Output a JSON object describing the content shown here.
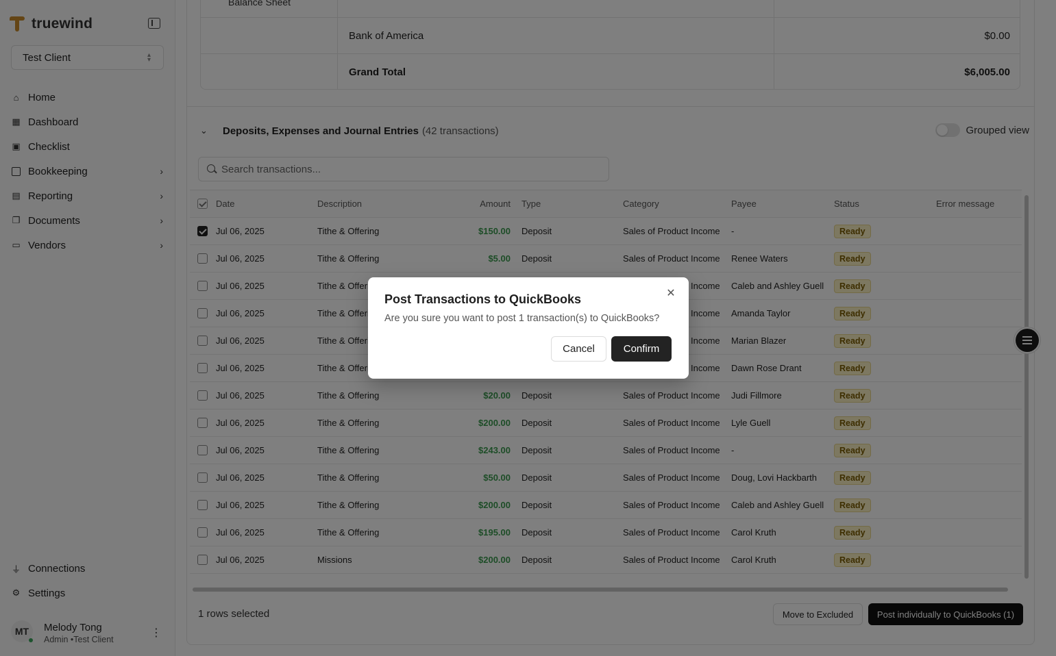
{
  "app": {
    "name": "truewind"
  },
  "client_select": {
    "value": "Test Client"
  },
  "nav": {
    "items": [
      {
        "label": "Home",
        "icon": "home-icon"
      },
      {
        "label": "Dashboard",
        "icon": "grid-icon"
      },
      {
        "label": "Checklist",
        "icon": "calendar-icon"
      },
      {
        "label": "Bookkeeping",
        "icon": "book-icon"
      },
      {
        "label": "Reporting",
        "icon": "report-icon"
      },
      {
        "label": "Documents",
        "icon": "documents-icon"
      },
      {
        "label": "Vendors",
        "icon": "wallet-icon"
      }
    ],
    "bottom": [
      {
        "label": "Connections",
        "icon": "plug-icon"
      },
      {
        "label": "Settings",
        "icon": "gear-icon"
      }
    ]
  },
  "user": {
    "initials": "MT",
    "name": "Melody Tong",
    "role": "Admin •Test Client"
  },
  "summary": {
    "top_label": "Balance Sheet",
    "rows": [
      {
        "label": "Bank of America",
        "value": "$0.00"
      },
      {
        "label": "Grand Total",
        "value": "$6,005.00"
      }
    ]
  },
  "section": {
    "title": "Deposits, Expenses and Journal Entries",
    "count": "(42 transactions)",
    "grouped_label": "Grouped view"
  },
  "search": {
    "placeholder": "Search transactions..."
  },
  "table": {
    "headers": {
      "date": "Date",
      "description": "Description",
      "amount": "Amount",
      "type": "Type",
      "category": "Category",
      "payee": "Payee",
      "status": "Status",
      "error": "Error message"
    },
    "rows": [
      {
        "date": "Jul 06, 2025",
        "description": "Tithe & Offering",
        "amount": "$150.00",
        "type": "Deposit",
        "category": "Sales of Product Income",
        "payee": "-",
        "status": "Ready"
      },
      {
        "date": "Jul 06, 2025",
        "description": "Tithe & Offering",
        "amount": "$5.00",
        "type": "Deposit",
        "category": "Sales of Product Income",
        "payee": "Renee Waters",
        "status": "Ready"
      },
      {
        "date": "Jul 06, 2025",
        "description": "Tithe & Offering",
        "amount": "",
        "type": "",
        "category": "Sales of Product Income",
        "payee": "Caleb and Ashley Guell",
        "status": "Ready"
      },
      {
        "date": "Jul 06, 2025",
        "description": "Tithe & Offering",
        "amount": "",
        "type": "",
        "category": "Sales of Product Income",
        "payee": "Amanda Taylor",
        "status": "Ready"
      },
      {
        "date": "Jul 06, 2025",
        "description": "Tithe & Offering",
        "amount": "",
        "type": "",
        "category": "Sales of Product Income",
        "payee": "Marian Blazer",
        "status": "Ready"
      },
      {
        "date": "Jul 06, 2025",
        "description": "Tithe & Offering",
        "amount": "",
        "type": "",
        "category": "Sales of Product Income",
        "payee": "Dawn Rose Drant",
        "status": "Ready"
      },
      {
        "date": "Jul 06, 2025",
        "description": "Tithe & Offering",
        "amount": "$20.00",
        "type": "Deposit",
        "category": "Sales of Product Income",
        "payee": "Judi Fillmore",
        "status": "Ready"
      },
      {
        "date": "Jul 06, 2025",
        "description": "Tithe & Offering",
        "amount": "$200.00",
        "type": "Deposit",
        "category": "Sales of Product Income",
        "payee": "Lyle Guell",
        "status": "Ready"
      },
      {
        "date": "Jul 06, 2025",
        "description": "Tithe & Offering",
        "amount": "$243.00",
        "type": "Deposit",
        "category": "Sales of Product Income",
        "payee": "-",
        "status": "Ready"
      },
      {
        "date": "Jul 06, 2025",
        "description": "Tithe & Offering",
        "amount": "$50.00",
        "type": "Deposit",
        "category": "Sales of Product Income",
        "payee": "Doug, Lovi Hackbarth",
        "status": "Ready"
      },
      {
        "date": "Jul 06, 2025",
        "description": "Tithe & Offering",
        "amount": "$200.00",
        "type": "Deposit",
        "category": "Sales of Product Income",
        "payee": "Caleb and Ashley Guell",
        "status": "Ready"
      },
      {
        "date": "Jul 06, 2025",
        "description": "Tithe & Offering",
        "amount": "$195.00",
        "type": "Deposit",
        "category": "Sales of Product Income",
        "payee": "Carol Kruth",
        "status": "Ready"
      },
      {
        "date": "Jul 06, 2025",
        "description": "Missions",
        "amount": "$200.00",
        "type": "Deposit",
        "category": "Sales of Product Income",
        "payee": "Carol Kruth",
        "status": "Ready"
      }
    ]
  },
  "footer": {
    "selected_text": "1 rows selected",
    "exclude_label": "Move to Excluded",
    "post_label": "Post individually to QuickBooks (1)"
  },
  "modal": {
    "title": "Post Transactions to QuickBooks",
    "message": "Are you sure you want to post 1 transaction(s) to QuickBooks?",
    "cancel_label": "Cancel",
    "confirm_label": "Confirm"
  },
  "colors": {
    "brand": "#c98a2b",
    "amount_green": "#3b9a4f",
    "status_ready_bg": "#fbf0c2"
  }
}
